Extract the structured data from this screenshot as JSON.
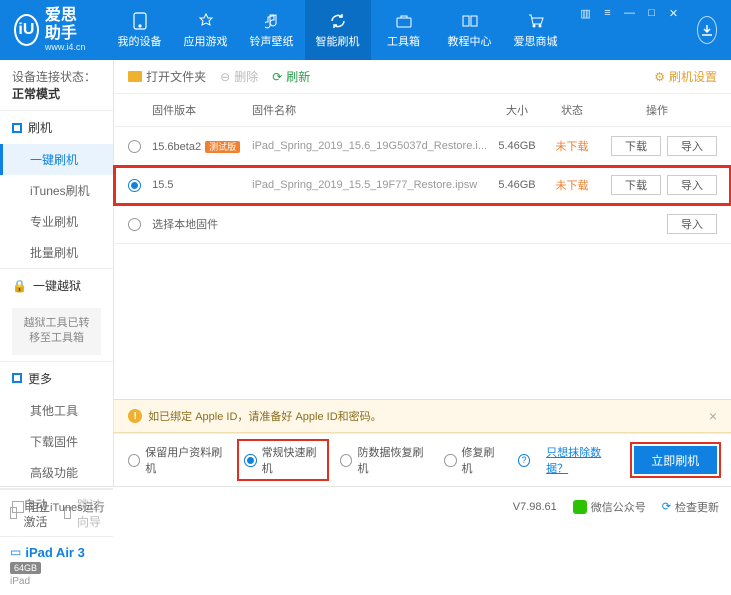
{
  "app": {
    "name": "爱思助手",
    "url": "www.i4.cn",
    "logo_letter": "iU"
  },
  "nav": {
    "items": [
      {
        "label": "我的设备"
      },
      {
        "label": "应用游戏"
      },
      {
        "label": "铃声壁纸"
      },
      {
        "label": "智能刷机"
      },
      {
        "label": "工具箱"
      },
      {
        "label": "教程中心"
      },
      {
        "label": "爱思商城"
      }
    ],
    "active_index": 3
  },
  "sidebar": {
    "conn_label": "设备连接状态：",
    "conn_value": "正常模式",
    "groups": {
      "flash": {
        "title": "刷机",
        "items": [
          "一键刷机",
          "iTunes刷机",
          "专业刷机",
          "批量刷机"
        ],
        "active_index": 0
      },
      "jailbreak": {
        "title": "一键越狱",
        "note": "越狱工具已转移至工具箱"
      },
      "more": {
        "title": "更多",
        "items": [
          "其他工具",
          "下载固件",
          "高级功能"
        ]
      }
    },
    "auto_activate": "自动激活",
    "skip_guide": "跳过向导",
    "device": {
      "name": "iPad Air 3",
      "storage": "64GB",
      "model": "iPad"
    }
  },
  "toolbar": {
    "open_folder": "打开文件夹",
    "delete": "删除",
    "refresh": "刷新",
    "settings": "刷机设置"
  },
  "table": {
    "headers": {
      "version": "固件版本",
      "name": "固件名称",
      "size": "大小",
      "status": "状态",
      "ops": "操作"
    },
    "download_btn": "下载",
    "import_btn": "导入",
    "rows": [
      {
        "version": "15.6beta2",
        "beta": "测试版",
        "name": "iPad_Spring_2019_15.6_19G5037d_Restore.i...",
        "size": "5.46GB",
        "status": "未下载",
        "selected": false
      },
      {
        "version": "15.5",
        "name": "iPad_Spring_2019_15.5_19F77_Restore.ipsw",
        "size": "5.46GB",
        "status": "未下载",
        "selected": true
      }
    ],
    "local_fw": "选择本地固件"
  },
  "warning": {
    "text": "如已绑定 Apple ID，请准备好 Apple ID和密码。"
  },
  "options": {
    "keep_data": "保留用户资料刷机",
    "normal_fast": "常规快速刷机",
    "anti_recovery": "防数据恢复刷机",
    "repair": "修复刷机",
    "exclude_link": "只想抹除数据？",
    "flash_now": "立即刷机",
    "selected": 1
  },
  "statusbar": {
    "block_itunes": "阻止iTunes运行",
    "version": "V7.98.61",
    "wechat": "微信公众号",
    "check_update": "检查更新"
  }
}
